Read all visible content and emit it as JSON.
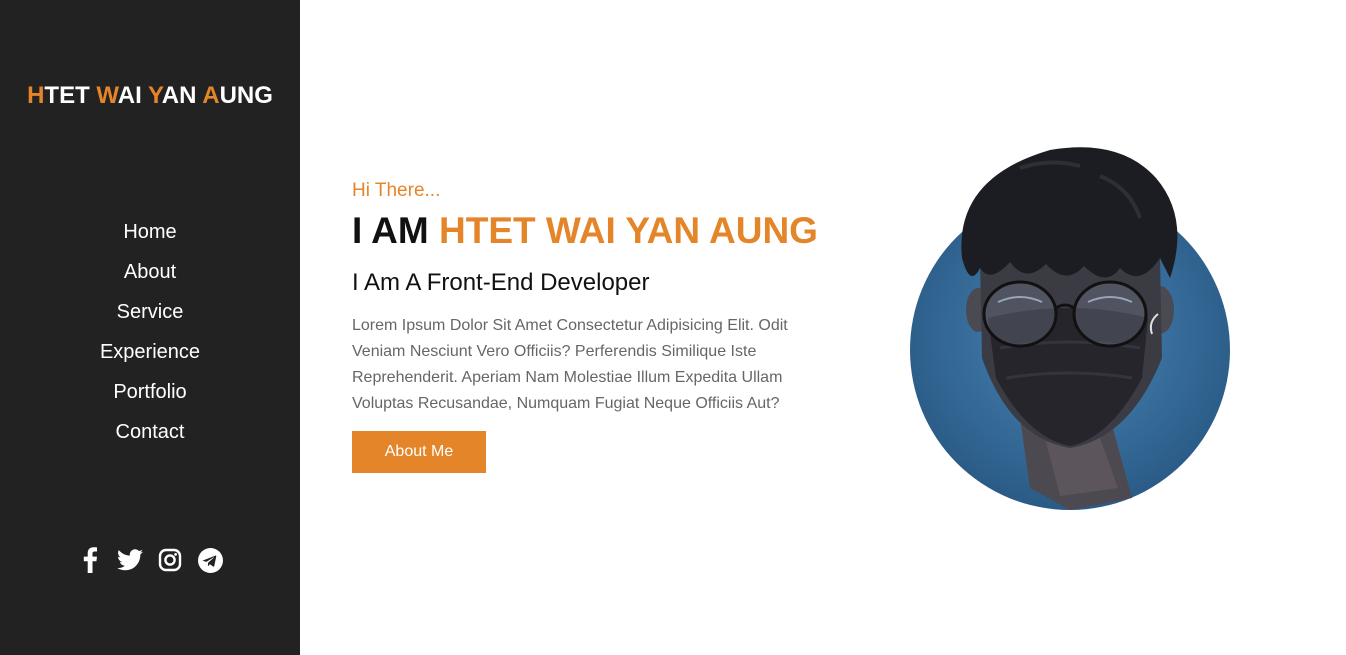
{
  "sidebar": {
    "logo": [
      {
        "initial": "H",
        "rest": "TET "
      },
      {
        "initial": "W",
        "rest": "AI "
      },
      {
        "initial": "Y",
        "rest": "AN "
      },
      {
        "initial": "A",
        "rest": "UNG"
      }
    ],
    "nav": [
      {
        "label": "Home"
      },
      {
        "label": "About"
      },
      {
        "label": "Service"
      },
      {
        "label": "Experience"
      },
      {
        "label": "Portfolio"
      },
      {
        "label": "Contact"
      }
    ],
    "social": [
      "facebook-icon",
      "twitter-icon",
      "instagram-icon",
      "telegram-icon"
    ]
  },
  "hero": {
    "greeting": "Hi There...",
    "headline_prefix": "I AM ",
    "headline_name": "HTET WAI YAN AUNG",
    "role": "I Am A Front-End Developer",
    "description": "Lorem Ipsum Dolor Sit Amet Consectetur Adipisicing Elit. Odit Veniam Nesciunt Vero Officiis? Perferendis Similique Iste Reprehenderit. Aperiam Nam Molestiae Illum Expedita Ullam Voluptas Recusandae, Numquam Fugiat Neque Officiis Aut?",
    "button": "About Me"
  },
  "colors": {
    "accent": "#e58529",
    "sidebar_bg": "#222222",
    "avatar_circle": "#2f6591"
  }
}
